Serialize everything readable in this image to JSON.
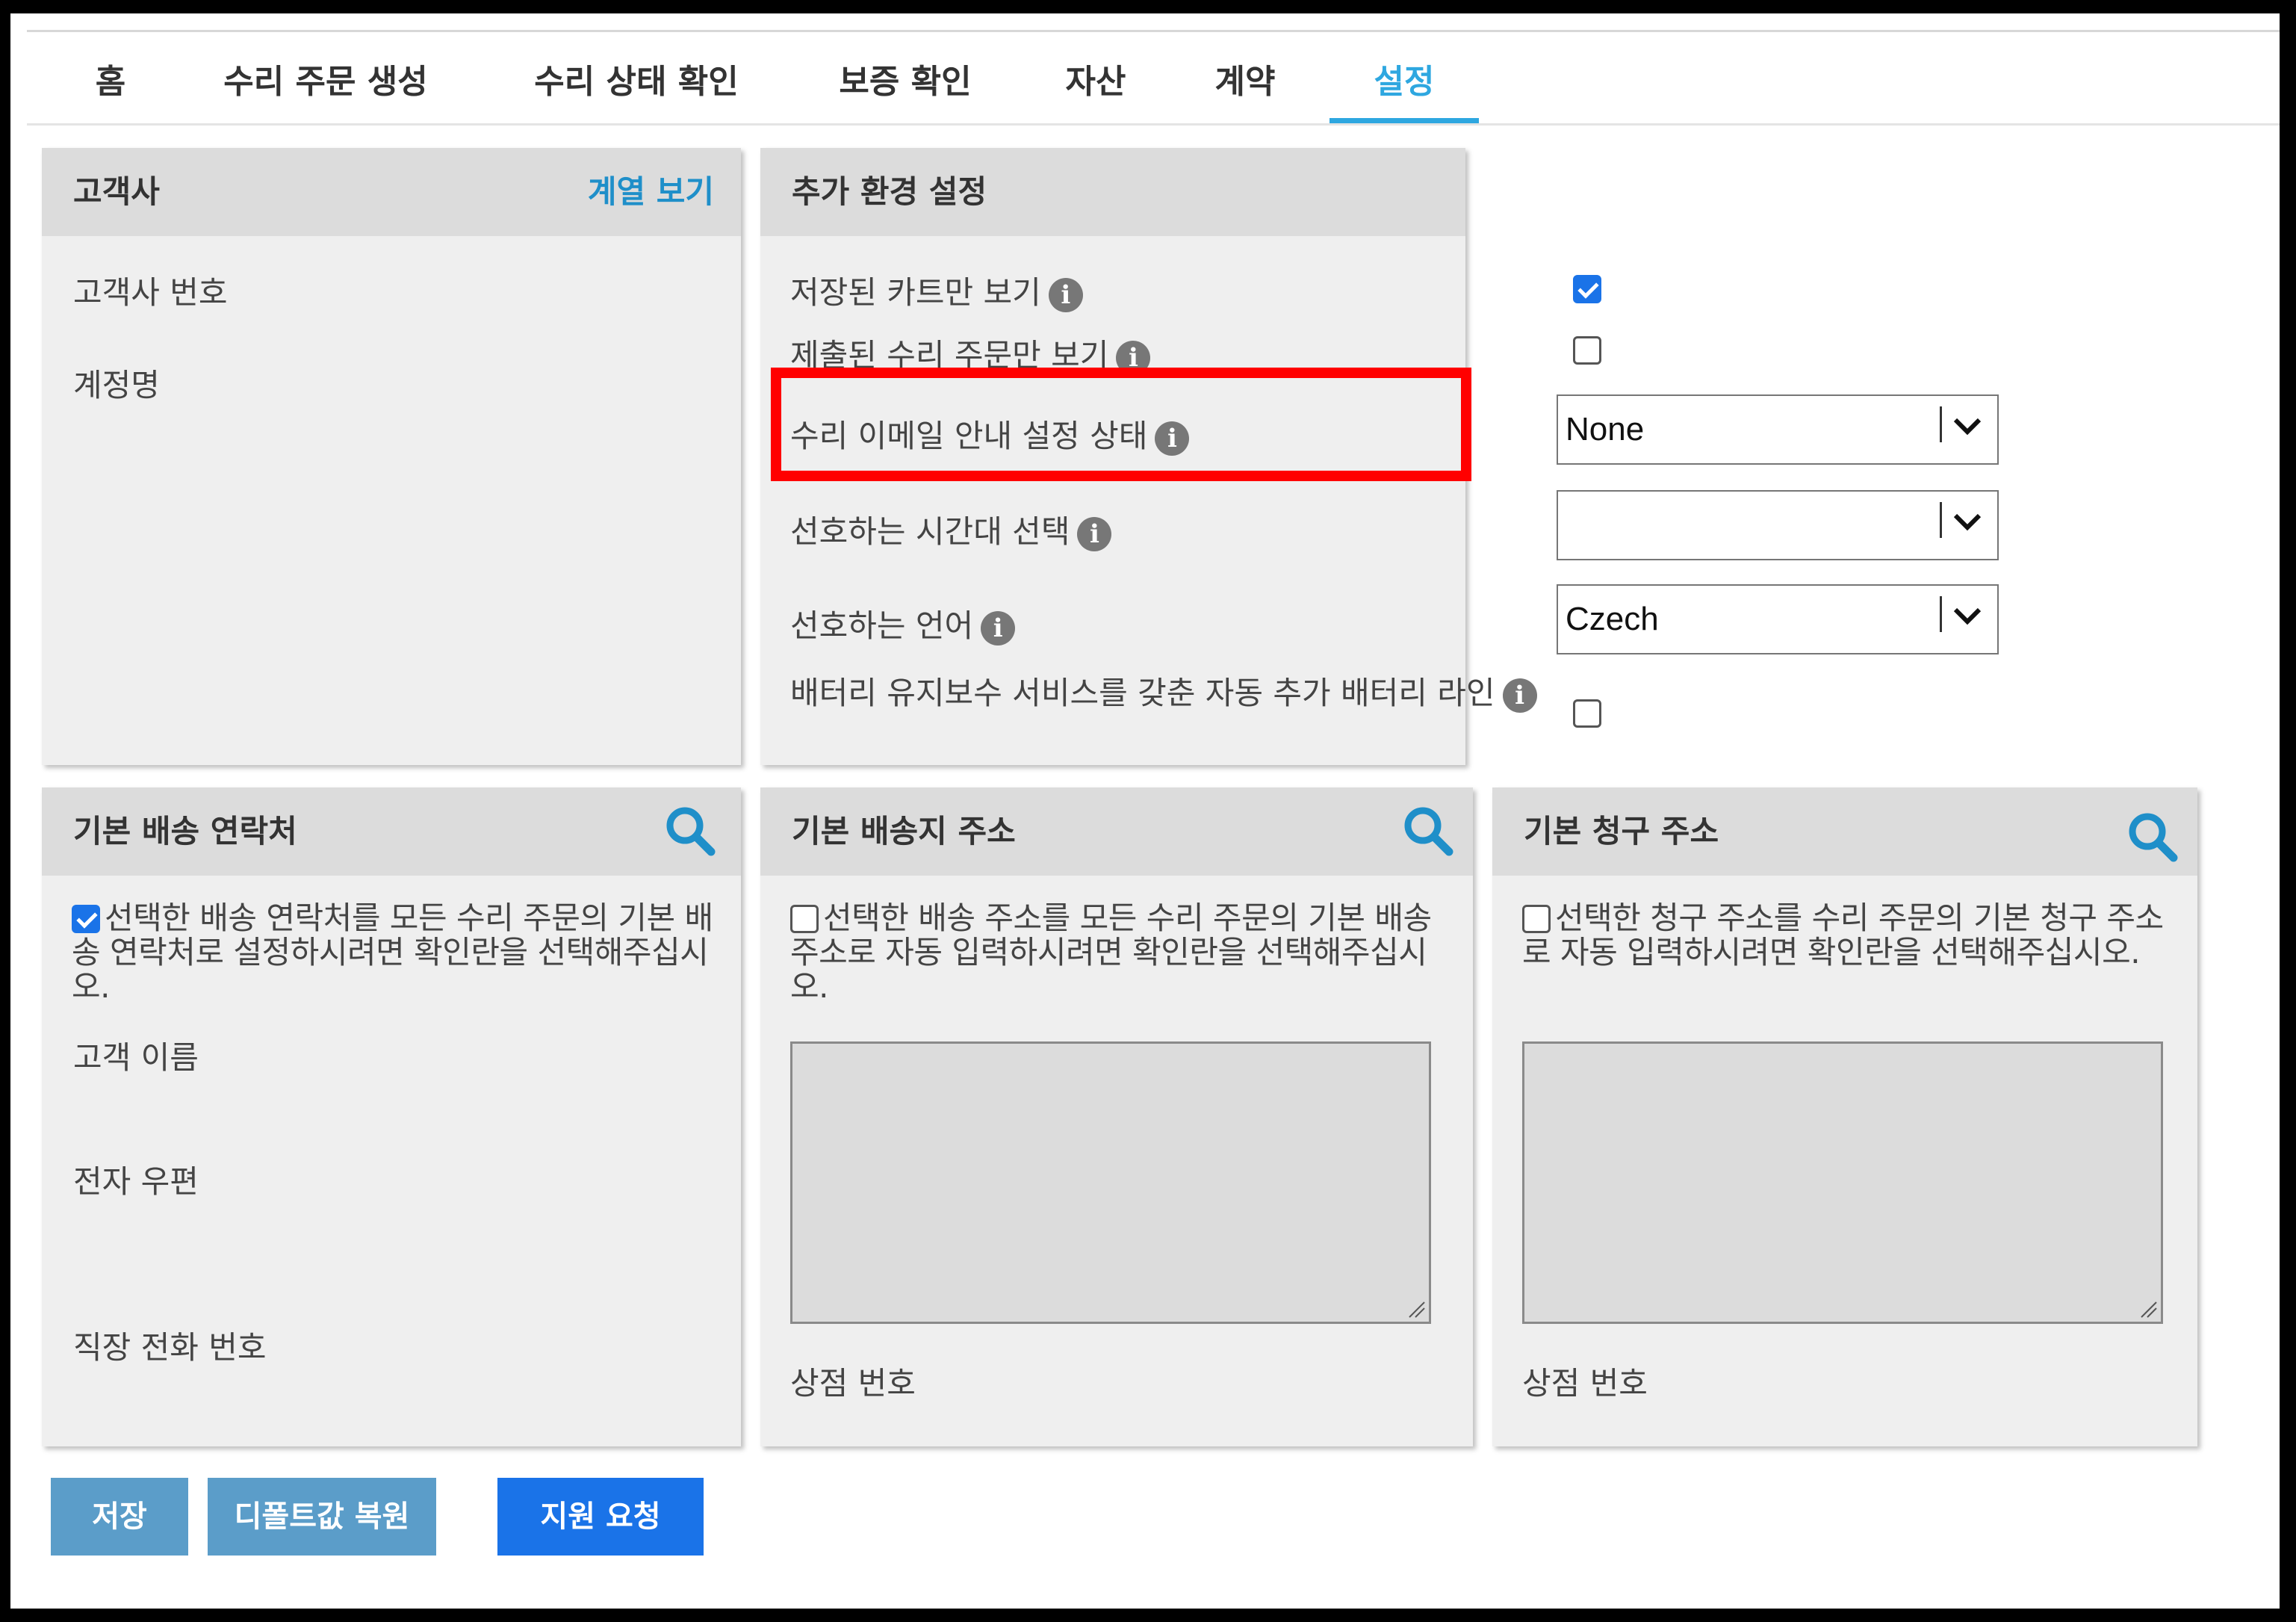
{
  "nav": {
    "tabs": [
      {
        "label": "홈"
      },
      {
        "label": "수리 주문 생성"
      },
      {
        "label": "수리 상태 확인"
      },
      {
        "label": "보증 확인"
      },
      {
        "label": "자산"
      },
      {
        "label": "계약"
      },
      {
        "label": "설정"
      }
    ],
    "active_tab": "설정"
  },
  "customer": {
    "title": "고객사",
    "hierarchy_link": "계열 보기",
    "fields": [
      "고객사 번호",
      "계정명"
    ]
  },
  "preferences": {
    "title": "추가 환경 설정",
    "saved_carts_only": {
      "label": "저장된 카트만 보기",
      "checked": true
    },
    "submitted_orders_only": {
      "label": "제출된 수리 주문만 보기",
      "checked": false
    },
    "email_notification": {
      "label": "수리 이메일 안내 설정 상태",
      "value": "None"
    },
    "timezone": {
      "label": "선호하는 시간대 선택",
      "value": ""
    },
    "language": {
      "label": "선호하는 언어",
      "value": "Czech"
    },
    "battery_line": {
      "label": "배터리 유지보수 서비스를 갖춘 자동 추가 배터리 라인",
      "checked": false
    }
  },
  "shipping_contact": {
    "title": "기본 배송 연락처",
    "default_desc": "선택한 배송 연락처를 모든 수리 주문의 기본 배송 연락처로 설정하시려면 확인란을 선택해주십시오.",
    "default_checked": true,
    "fields": [
      "고객 이름",
      "전자 우편",
      "직장 전화 번호"
    ]
  },
  "shipping_address": {
    "title": "기본 배송지 주소",
    "default_desc": "선택한 배송 주소를 모든 수리 주문의 기본 배송 주소로 자동 입력하시려면 확인란을 선택해주십시오.",
    "default_checked": false,
    "store_number_label": "상점 번호"
  },
  "billing_address": {
    "title": "기본 청구 주소",
    "default_desc": "선택한 청구 주소를 수리 주문의 기본 청구 주소로 자동 입력하시려면 확인란을 선택해주십시오.",
    "default_checked": false,
    "store_number_label": "상점 번호"
  },
  "actions": {
    "save": "저장",
    "restore_defaults": "디폴트값 복원",
    "support_request": "지원 요청"
  },
  "icons": {
    "info": "info-icon",
    "search": "search-icon",
    "dropdown": "chevron-down-icon"
  },
  "colors": {
    "accent": "#2ea7e0",
    "link": "#1f8fc9",
    "highlight": "#ff0000",
    "button_light": "#5b9dc9",
    "button_primary": "#1a73e8"
  }
}
